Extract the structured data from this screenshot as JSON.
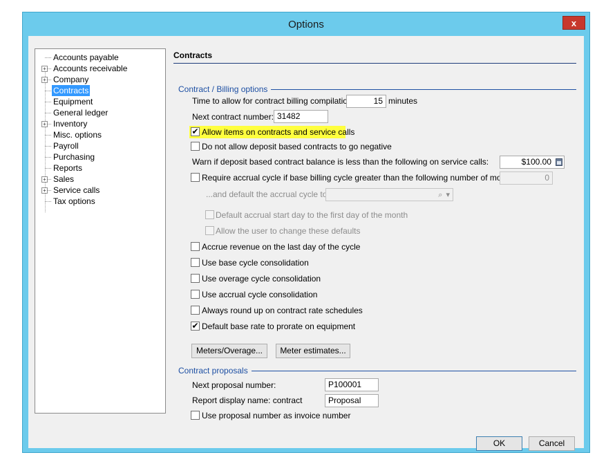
{
  "window": {
    "title": "Options",
    "close_label": "x"
  },
  "tree": {
    "items": [
      {
        "label": "Accounts payable",
        "expandable": false,
        "selected": false
      },
      {
        "label": "Accounts receivable",
        "expandable": true,
        "selected": false
      },
      {
        "label": "Company",
        "expandable": true,
        "selected": false
      },
      {
        "label": "Contracts",
        "expandable": false,
        "selected": true
      },
      {
        "label": "Equipment",
        "expandable": false,
        "selected": false
      },
      {
        "label": "General ledger",
        "expandable": false,
        "selected": false
      },
      {
        "label": "Inventory",
        "expandable": true,
        "selected": false
      },
      {
        "label": "Misc. options",
        "expandable": false,
        "selected": false
      },
      {
        "label": "Payroll",
        "expandable": false,
        "selected": false
      },
      {
        "label": "Purchasing",
        "expandable": false,
        "selected": false
      },
      {
        "label": "Reports",
        "expandable": false,
        "selected": false
      },
      {
        "label": "Sales",
        "expandable": true,
        "selected": false
      },
      {
        "label": "Service calls",
        "expandable": true,
        "selected": false
      },
      {
        "label": "Tax options",
        "expandable": false,
        "selected": false
      }
    ],
    "expand_glyph": "+"
  },
  "panel": {
    "title": "Contracts",
    "billing": {
      "group_label": "Contract / Billing options",
      "compile_time_label": "Time to allow for contract billing compilation:",
      "compile_time_value": "15",
      "compile_time_unit": "minutes",
      "next_contract_label": "Next contract number:",
      "next_contract_value": "31482",
      "allow_items_label": "Allow items on contracts and service calls",
      "allow_items_checked": true,
      "no_negative_label": "Do not allow deposit based contracts to go negative",
      "no_negative_checked": false,
      "warn_label": "Warn if deposit based contract balance is less than the following on service calls:",
      "warn_value": "$100.00",
      "require_accrual_label": "Require accrual cycle if base billing cycle greater than the following number of months:",
      "require_accrual_checked": false,
      "require_accrual_value": "0",
      "default_accrual_label": "...and default the accrual cycle to:",
      "default_accrual_value": "",
      "default_start_day_label": "Default accrual start day to the first day of the month",
      "default_start_day_checked": false,
      "allow_change_label": "Allow the user to change these defaults",
      "allow_change_checked": false,
      "accrue_revenue_label": "Accrue revenue on the last day of the cycle",
      "accrue_revenue_checked": false,
      "base_consol_label": "Use base cycle consolidation",
      "base_consol_checked": false,
      "overage_consol_label": "Use overage cycle consolidation",
      "overage_consol_checked": false,
      "accrual_consol_label": "Use accrual cycle consolidation",
      "accrual_consol_checked": false,
      "round_up_label": "Always round up on contract rate schedules",
      "round_up_checked": false,
      "prorate_label": "Default base rate to prorate on equipment",
      "prorate_checked": true,
      "meters_button": "Meters/Overage...",
      "meter_estimates_button": "Meter estimates..."
    },
    "proposals": {
      "group_label": "Contract proposals",
      "next_proposal_label": "Next proposal number:",
      "next_proposal_value": "P100001",
      "display_name_label": "Report display name: contract",
      "display_name_value": "Proposal",
      "use_proposal_label": "Use proposal number as invoice number",
      "use_proposal_checked": false
    }
  },
  "footer": {
    "ok_label": "OK",
    "cancel_label": "Cancel"
  },
  "check_glyph": "✔",
  "colors": {
    "title_bar": "#6ccbec",
    "close": "#c7382c",
    "selection": "#3399ff",
    "highlight": "#ffff3e",
    "group_label": "#1d4fa3"
  }
}
